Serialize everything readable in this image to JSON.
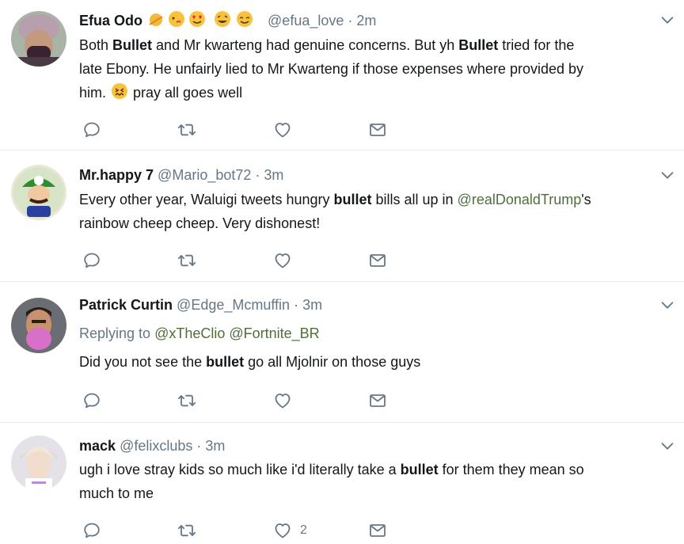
{
  "tweets": [
    {
      "name": "Efua Odo",
      "handle": "@efua_love",
      "dot": "·",
      "time": "2m",
      "line1_a": "Both ",
      "line1_b": "Bullet",
      "line1_c": " and Mr kwarteng had genuine concerns. But yh ",
      "line1_d": "Bullet",
      "line1_e": " tried for the",
      "line2": "late Ebony. He unfairly lied to Mr Kwarteng if those expenses where provided by",
      "line3_a": "him. ",
      "line3_b": " pray all goes well",
      "like_count": ""
    },
    {
      "name": "Mr.happy 7",
      "handle": "@Mario_bot72",
      "dot": "·",
      "time": "3m",
      "line1_a": "Every other year, Waluigi tweets hungry ",
      "line1_b": "bullet",
      "line1_c": " bills all up in ",
      "line1_d": "@realDonaldTrump",
      "line1_e": "'s",
      "line2": "rainbow cheep cheep. Very dishonest!",
      "like_count": ""
    },
    {
      "name": "Patrick Curtin",
      "handle": "@Edge_Mcmuffin",
      "dot": "·",
      "time": "3m",
      "reply_prefix": "Replying to ",
      "reply_m1": "@xTheClio",
      "reply_m2": "@Fortnite_BR",
      "line1_a": "Did you not see the ",
      "line1_b": "bullet",
      "line1_c": " go all Mjolnir on those guys",
      "like_count": ""
    },
    {
      "name": "mack",
      "handle": "@felixclubs",
      "dot": "·",
      "time": "3m",
      "line1_a": "ugh i love stray kids so much like i'd literally take a ",
      "line1_b": "bullet",
      "line1_c": " for them they mean so",
      "line2": "much to me",
      "like_count": "2"
    }
  ],
  "colors": {
    "text": "#14171a",
    "muted": "#657786",
    "mention": "#4f6f3a",
    "divider": "#e6ecf0"
  }
}
